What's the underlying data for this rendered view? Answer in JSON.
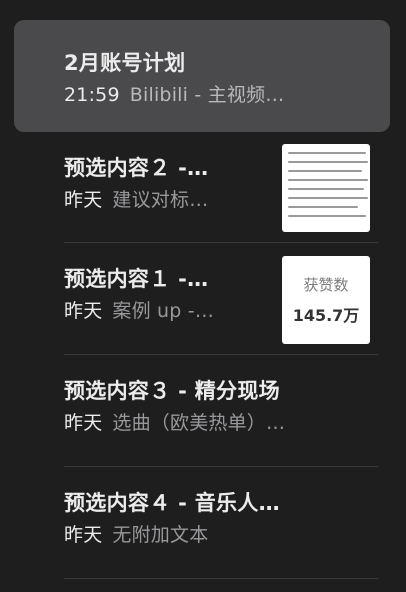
{
  "notes": [
    {
      "title": "2月账号计划",
      "time": "21:59",
      "preview": "Bilibili - 主视频…",
      "selected": true
    },
    {
      "title": "预选内容２ -…",
      "time": "昨天",
      "preview": "建议对标…",
      "thumbnail": "document-text-image"
    },
    {
      "title": "预选内容１ -…",
      "time": "昨天",
      "preview": "案例 up -…",
      "thumbnail": "stats-image",
      "thumb_label": "获赞数",
      "thumb_value": "145.7万"
    },
    {
      "title": "预选内容３ - 精分现场",
      "time": "昨天",
      "preview": "选曲（欧美热单）…"
    },
    {
      "title": "预选内容４ - 音乐人…",
      "time": "昨天",
      "preview": "无附加文本"
    }
  ]
}
